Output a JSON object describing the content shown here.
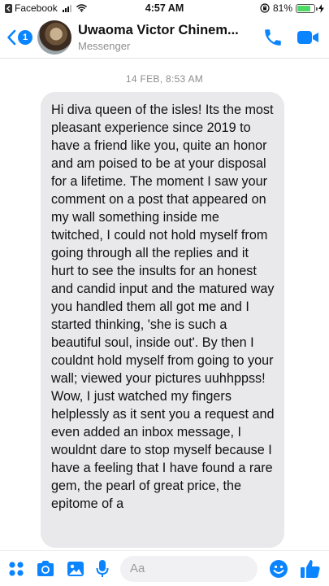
{
  "status_bar": {
    "back_app_label": "Facebook",
    "time": "4:57 AM",
    "battery_text": "81%",
    "battery_level": 0.81
  },
  "header": {
    "unread_count": "1",
    "contact_name": "Uwaoma Victor Chinem...",
    "subtitle": "Messenger"
  },
  "thread": {
    "timestamp": "14 FEB, 8:53 AM",
    "message_text": "Hi diva queen of the isles! Its the most pleasant experience since 2019 to have a friend like you, quite an honor and am poised to be at your disposal for a lifetime. The moment I saw your comment on a post that appeared on my wall something inside me twitched, I could not hold myself from going through all the replies and it hurt to see the insults for an honest and candid input and the matured way you handled them all got me and I started thinking, 'she is such a beautiful soul, inside out'. By then I couldnt hold myself from going to your wall; viewed your pictures uuhhppss! Wow, I just watched my fingers helplessly as it sent you a request and even added an inbox message, I wouldnt dare to stop myself because I have a feeling that I have found a rare gem, the pearl of great price, the epitome of a"
  },
  "composer": {
    "placeholder": "Aa"
  },
  "icons": {
    "more": "four-dots-icon",
    "camera": "camera-icon",
    "gallery": "image-icon",
    "mic": "microphone-icon",
    "emoji": "emoji-icon",
    "like": "thumbs-up-icon",
    "call": "phone-icon",
    "video": "video-camera-icon"
  },
  "colors": {
    "accent": "#0b84ff",
    "bubble": "#e9e9eb",
    "battery": "#4cd964"
  }
}
